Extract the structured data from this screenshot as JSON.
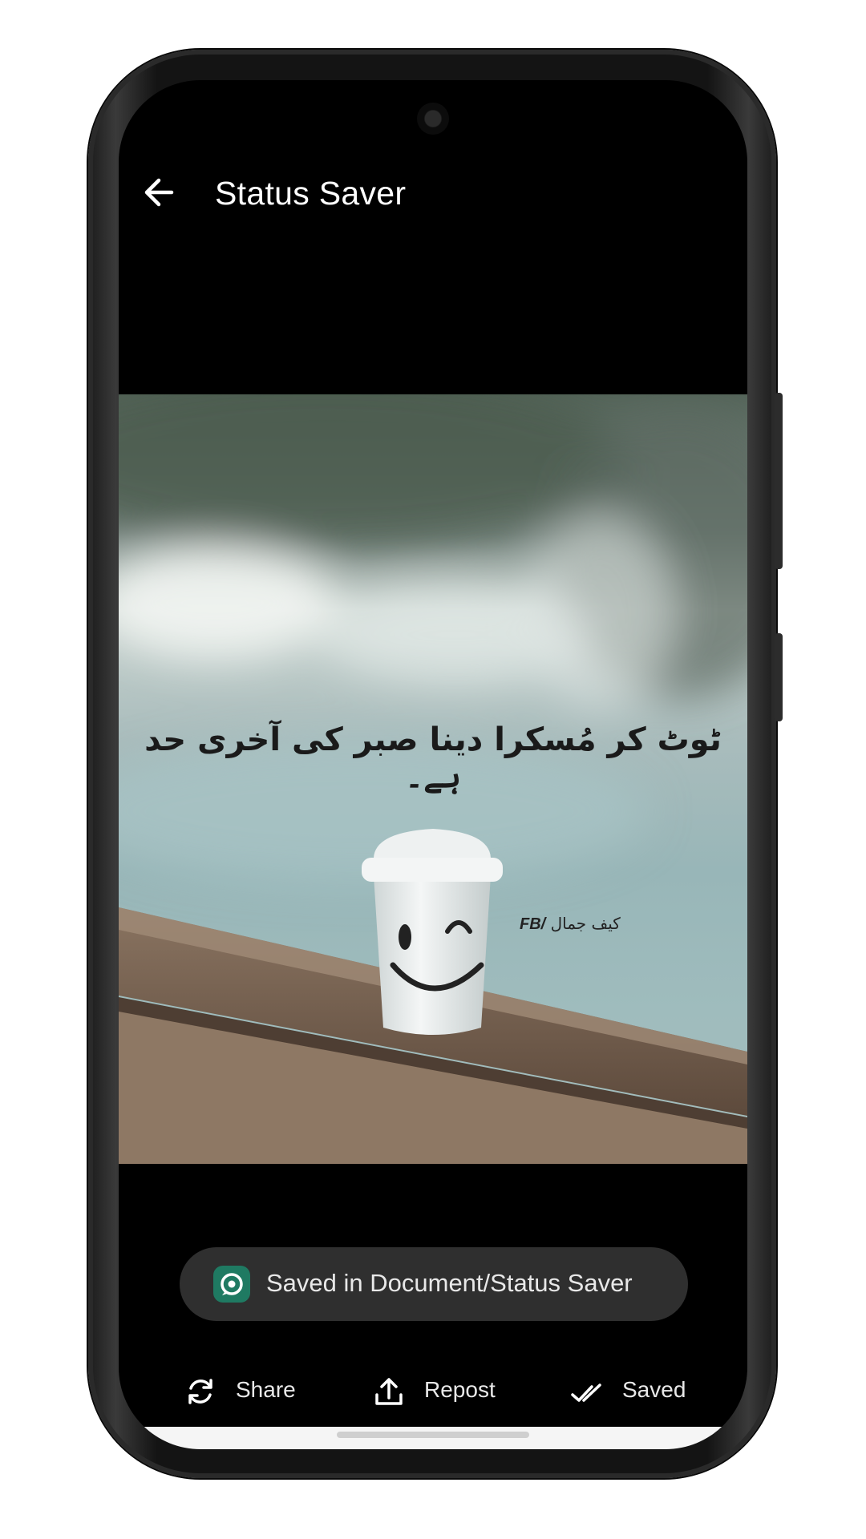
{
  "app_bar": {
    "back_icon": "arrow-left-icon",
    "title": "Status Saver"
  },
  "status": {
    "quote": "ٹوٹ کر مُسکرا دینا صبر کی آخری حد ہے۔",
    "credit_name": "کیف جمال",
    "credit_tag": "FB/"
  },
  "snackbar": {
    "icon": "status-saver-app-icon",
    "message": "Saved in Document/Status Saver"
  },
  "actions": [
    {
      "icon": "share-sync-icon",
      "label": "Share"
    },
    {
      "icon": "upload-icon",
      "label": "Repost"
    },
    {
      "icon": "double-check-icon",
      "label": "Saved"
    }
  ],
  "colors": {
    "background": "#000000",
    "snackbar": "#2f2f2f",
    "app_icon": "#1f7a62",
    "text": "#ffffff"
  }
}
